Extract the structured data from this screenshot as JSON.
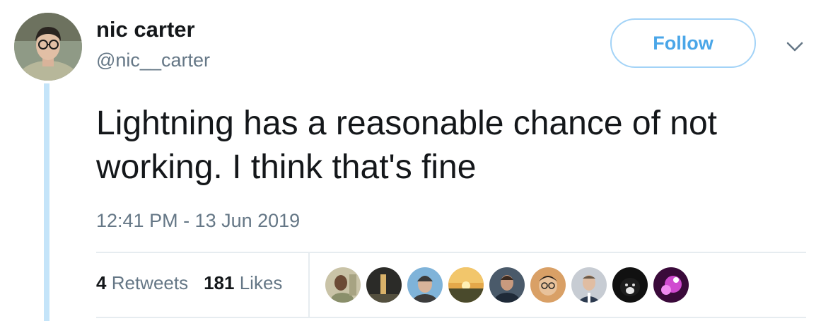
{
  "tweet": {
    "author": {
      "name": "nic carter",
      "handle": "@nic__carter"
    },
    "follow_label": "Follow",
    "text": "Lightning has a reasonable chance of not working. I think that's fine",
    "timestamp": "12:41 PM - 13 Jun 2019",
    "stats": {
      "retweets_count": "4",
      "retweets_label": "Retweets",
      "likes_count": "181",
      "likes_label": "Likes"
    }
  },
  "icons": {
    "caret": "chevron-down-icon",
    "avatar": "avatar"
  },
  "colors": {
    "follow_border": "#a3d3f7",
    "follow_text": "#4aa6e8",
    "secondary_text": "#657786",
    "primary_text": "#14171a",
    "thread_line": "#c4e4f9",
    "divider": "#e6ecf0"
  }
}
